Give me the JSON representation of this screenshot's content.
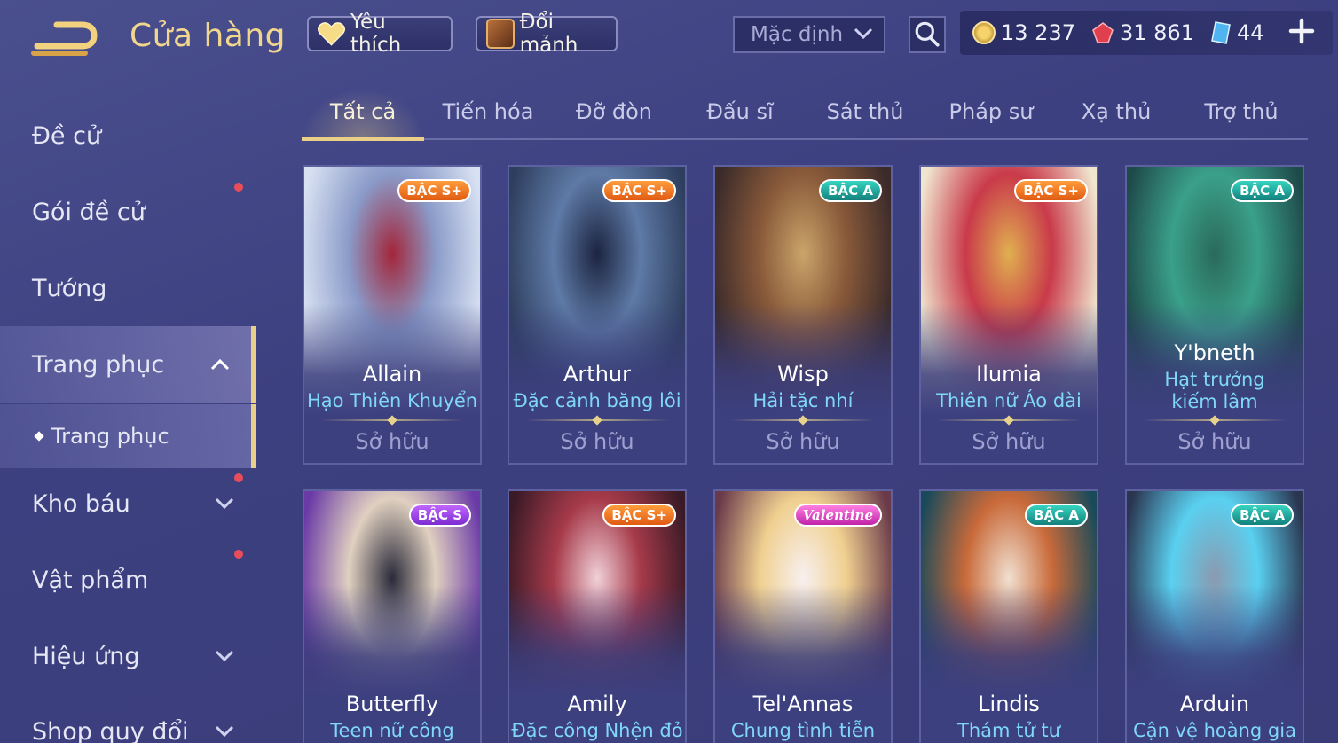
{
  "header": {
    "title": "Cửa hàng",
    "favorite_label": "Yêu thích",
    "shard_label": "Đổi mảnh",
    "sort": {
      "selected": "Mặc định"
    }
  },
  "currency": {
    "gold": "13 237",
    "ruby": "31 861",
    "voucher": "44"
  },
  "sidebar": {
    "items": [
      {
        "label": "Đề cử"
      },
      {
        "label": "Gói đề cử"
      },
      {
        "label": "Tướng"
      },
      {
        "label": "Trang phục"
      },
      {
        "label": "Trang phục"
      },
      {
        "label": "Kho báu"
      },
      {
        "label": "Vật phẩm"
      },
      {
        "label": "Hiệu ứng"
      },
      {
        "label": "Shop quy đổi"
      }
    ]
  },
  "tabs": [
    "Tất cả",
    "Tiến hóa",
    "Đỡ đòn",
    "Đấu sĩ",
    "Sát thủ",
    "Pháp sư",
    "Xạ thủ",
    "Trợ thủ"
  ],
  "cards": [
    {
      "hero": "Allain",
      "skin": "Hạo Thiên Khuyển",
      "tier": "BẬC S+",
      "status": "Sở hữu",
      "colors": [
        "#d8e1f2",
        "#8a9bc9",
        "#a3263a"
      ]
    },
    {
      "hero": "Arthur",
      "skin": "Đặc cảnh băng lôi",
      "tier": "BẬC S+",
      "status": "Sở hữu",
      "colors": [
        "#2e3e5e",
        "#5e7aa6",
        "#1c2440"
      ]
    },
    {
      "hero": "Wisp",
      "skin": "Hải tặc nhí",
      "tier": "BẬC A",
      "status": "Sở hữu",
      "colors": [
        "#3a2a2a",
        "#8a5a3a",
        "#c9a46a"
      ]
    },
    {
      "hero": "Ilumia",
      "skin": "Thiên nữ Áo dài",
      "tier": "BẬC S+",
      "status": "Sở hữu",
      "colors": [
        "#f0e6d0",
        "#c93a4a",
        "#e0b050"
      ]
    },
    {
      "hero": "Y'bneth",
      "skin": "Hạt trưởng kiếm lâm",
      "tier": "BẬC A",
      "status": "Sở hữu",
      "colors": [
        "#1f4a4a",
        "#3aa08a",
        "#2a6a5a"
      ]
    },
    {
      "hero": "Butterfly",
      "skin": "Teen nữ công nghệ",
      "tier": "BẬC S",
      "status": "",
      "colors": [
        "#6a3aa6",
        "#e0d0c0",
        "#2a2a3a"
      ]
    },
    {
      "hero": "Amily",
      "skin": "Đặc công Nhện đỏ",
      "tier": "BẬC S+",
      "status": "",
      "colors": [
        "#3a1a26",
        "#a63a4a",
        "#f0d0d8"
      ]
    },
    {
      "hero": "Tel'Annas",
      "skin": "Chung tình tiễn",
      "tier": "Valentine",
      "status": "",
      "colors": [
        "#6a3a4a",
        "#f0d090",
        "#f8f0f0"
      ]
    },
    {
      "hero": "Lindis",
      "skin": "Thám tử tư",
      "tier": "BẬC A",
      "status": "",
      "colors": [
        "#1a4a5a",
        "#c96a3a",
        "#f0e0d0"
      ]
    },
    {
      "hero": "Arduin",
      "skin": "Cận vệ hoàng gia",
      "tier": "BẬC A",
      "status": "",
      "colors": [
        "#2a3550",
        "#5ad0f0",
        "#8a9ab0"
      ]
    }
  ]
}
